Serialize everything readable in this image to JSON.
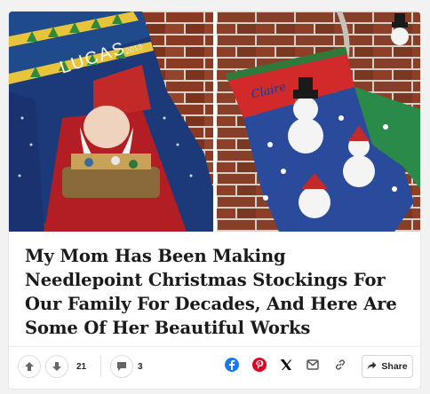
{
  "post": {
    "title": "My Mom Has Been Making Needlepoint Christmas Stockings For Our Family For Decades, And Here Are Some Of Her Beautiful Works",
    "images": [
      {
        "name": "Lucas stocking",
        "stitched_name": "LUCAS",
        "stitched_year": "2013"
      },
      {
        "name": "Snowman stocking",
        "stitched_name": "Claire"
      }
    ]
  },
  "actions": {
    "upvote_count": "21",
    "comment_count": "3",
    "share_label": "Share"
  },
  "icons": {
    "upvote": "arrow-up-icon",
    "downvote": "arrow-down-icon",
    "comment": "comment-bubble-icon",
    "facebook": "facebook-icon",
    "pinterest": "pinterest-icon",
    "x": "x-icon",
    "email": "envelope-icon",
    "link": "link-icon",
    "share": "share-arrow-icon"
  },
  "colors": {
    "facebook": "#1877f2",
    "pinterest": "#e60023",
    "icon_gray": "#666666",
    "title": "#1a1a1a"
  }
}
